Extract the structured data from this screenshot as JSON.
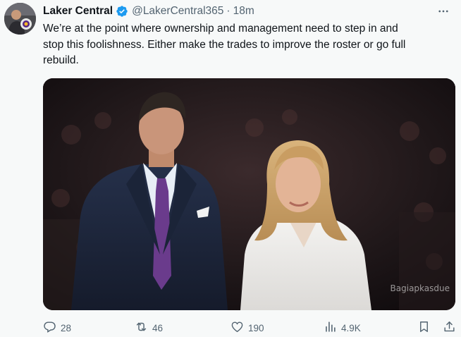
{
  "author": {
    "display_name": "Laker Central",
    "handle": "@LakerCentral365",
    "separator": "·",
    "time": "18m",
    "verified": true
  },
  "post": {
    "text": "We’re at the point where ownership and management need to step in and\nstop this foolishness. Either make the trades to improve the roster or go full\nrebuild."
  },
  "media": {
    "watermark": "Bagiapkasdue"
  },
  "actions": {
    "replies": "28",
    "reposts": "46",
    "likes": "190",
    "views": "4.9K"
  },
  "icons": {
    "menu": "more-horizontal-icon",
    "reply": "reply-icon",
    "repost": "repost-icon",
    "like": "heart-icon",
    "views": "views-chart-icon",
    "bookmark": "bookmark-icon",
    "share": "share-icon",
    "verified": "verified-badge-icon"
  },
  "colors": {
    "verified": "#1d9bf0",
    "muted": "#536471",
    "text": "#0f1419",
    "background": "#f7f9f9"
  }
}
